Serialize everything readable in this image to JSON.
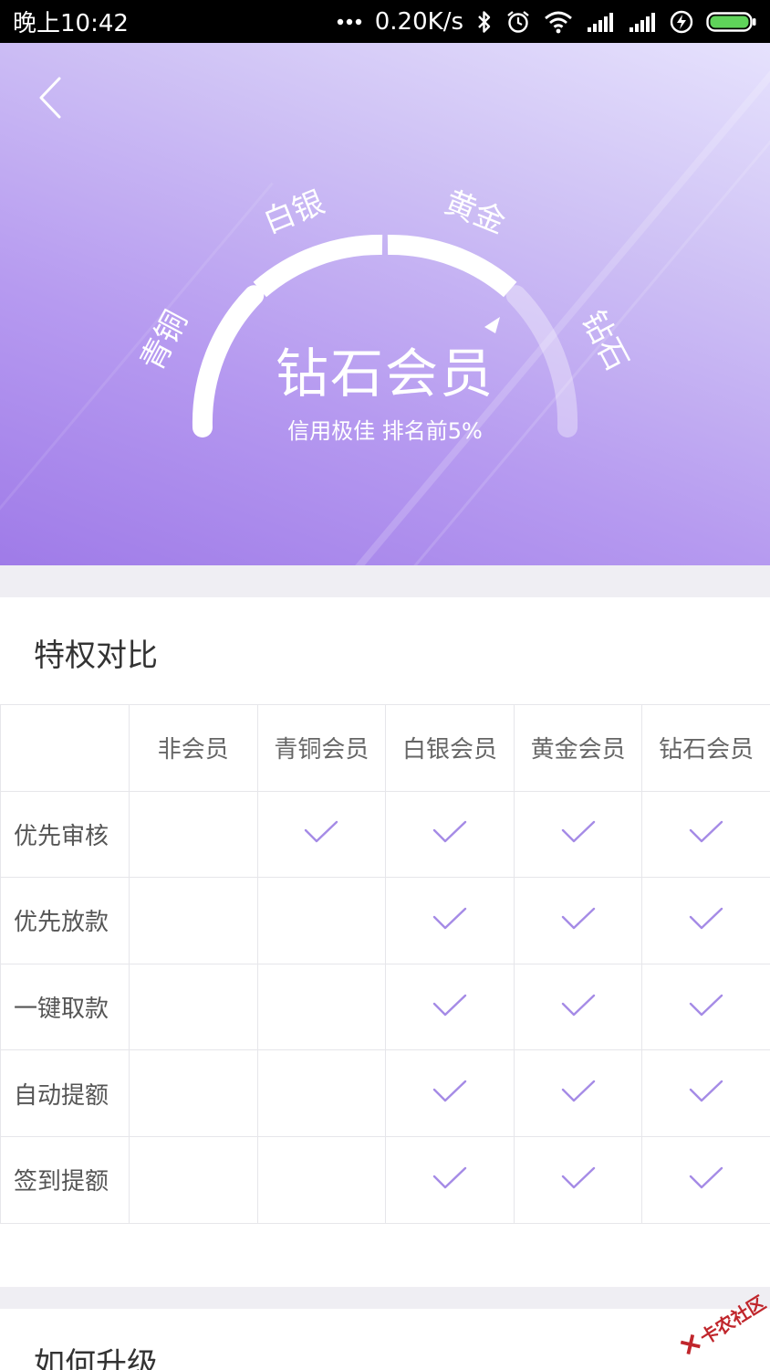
{
  "status_bar": {
    "time": "晚上10:42",
    "network_speed": "0.20K/s",
    "icons": [
      "dots-icon",
      "bluetooth-icon",
      "alarm-icon",
      "wifi-icon",
      "signal-icon",
      "signal-icon",
      "charging-icon",
      "battery-icon"
    ]
  },
  "hero": {
    "tiers": [
      "青铜",
      "白银",
      "黄金",
      "钻石"
    ],
    "current_tier": "钻石会员",
    "subtitle": "信用极佳  排名前5%",
    "gradient_colors": [
      "#9f7be8",
      "#e6e2fd"
    ]
  },
  "privileges": {
    "title": "特权对比",
    "columns": [
      "",
      "非会员",
      "青铜会员",
      "白银会员",
      "黄金会员",
      "钻石会员"
    ],
    "rows": [
      {
        "label": "优先审核",
        "checks": [
          false,
          true,
          true,
          true,
          true
        ]
      },
      {
        "label": "优先放款",
        "checks": [
          false,
          false,
          true,
          true,
          true
        ]
      },
      {
        "label": "一键取款",
        "checks": [
          false,
          false,
          true,
          true,
          true
        ]
      },
      {
        "label": "自动提额",
        "checks": [
          false,
          false,
          true,
          true,
          true
        ]
      },
      {
        "label": "签到提额",
        "checks": [
          false,
          false,
          true,
          true,
          true
        ]
      }
    ],
    "check_color": "#a58be6"
  },
  "upgrade": {
    "title": "如何升级"
  },
  "watermark": {
    "text": "卡农社区"
  }
}
